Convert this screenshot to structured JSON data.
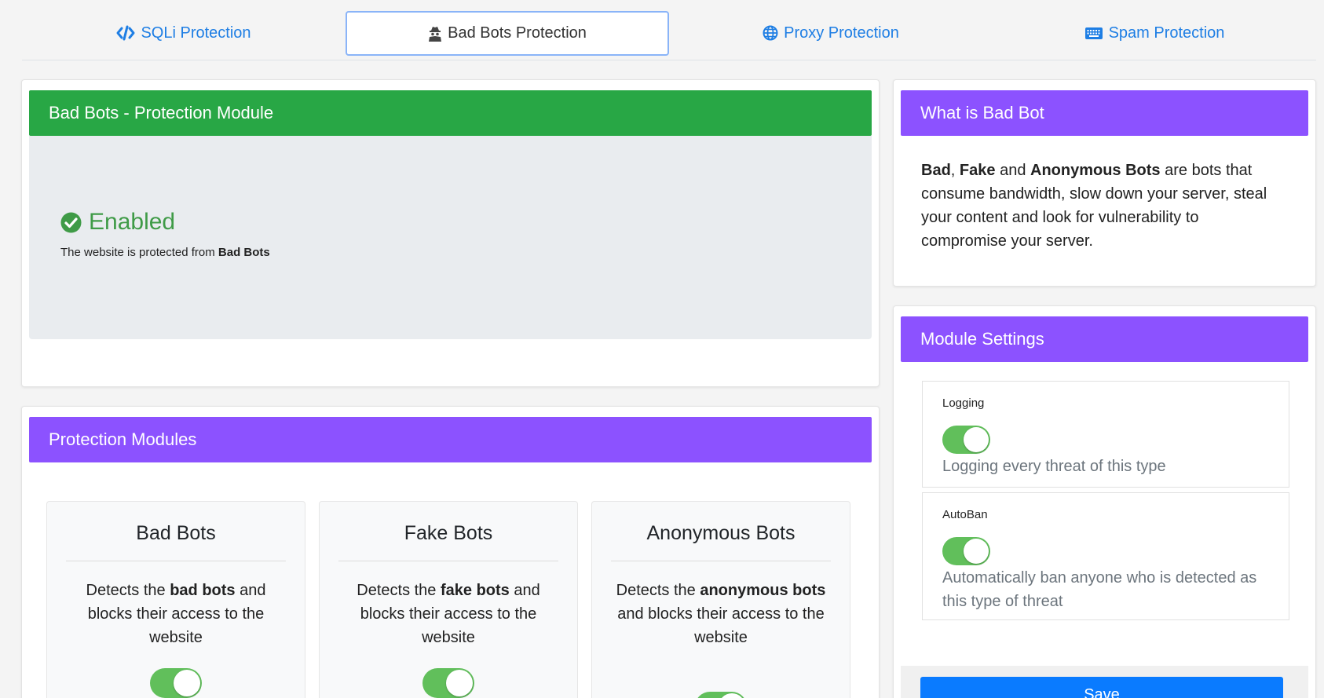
{
  "tabs": [
    {
      "label": "SQLi Protection",
      "icon": "code-icon",
      "active": false
    },
    {
      "label": "Bad Bots Protection",
      "icon": "user-secret-icon",
      "active": true
    },
    {
      "label": "Proxy Protection",
      "icon": "globe-icon",
      "active": false
    },
    {
      "label": "Spam Protection",
      "icon": "keyboard-icon",
      "active": false
    }
  ],
  "status": {
    "header": "Bad Bots - Protection Module",
    "state": "Enabled",
    "text_prefix": "The website is protected from ",
    "text_bold": "Bad Bots"
  },
  "modules": {
    "header": "Protection Modules",
    "items": [
      {
        "title": "Bad Bots",
        "desc_pre": "Detects the ",
        "desc_bold": "bad bots",
        "desc_post": " and blocks their access to the website",
        "enabled": true
      },
      {
        "title": "Fake Bots",
        "desc_pre": "Detects the ",
        "desc_bold": "fake bots",
        "desc_post": " and blocks their access to the website",
        "enabled": true
      },
      {
        "title": "Anonymous Bots",
        "desc_pre": "Detects the ",
        "desc_bold": "anonymous bots",
        "desc_post": " and blocks their access to the website",
        "enabled": true
      }
    ]
  },
  "info": {
    "header": "What is Bad Bot",
    "bold1": "Bad",
    "sep1": ", ",
    "bold2": "Fake",
    "sep2": " and ",
    "bold3": "Anonymous Bots",
    "rest": " are bots that consume bandwidth, slow down your server, steal your content and look for vulnerability to compromise your server."
  },
  "settings": {
    "header": "Module Settings",
    "logging": {
      "label": "Logging",
      "desc": "Logging every threat of this type",
      "enabled": true
    },
    "autoban": {
      "label": "AutoBan",
      "desc": "Automatically ban anyone who is detected as this type of threat",
      "enabled": true
    },
    "save_label": "Save"
  },
  "colors": {
    "green_header": "#28a745",
    "purple_header": "#8c52ff",
    "toggle_on": "#61bf5b",
    "link_blue": "#1e7ee4",
    "save_blue": "#0a7bff"
  }
}
